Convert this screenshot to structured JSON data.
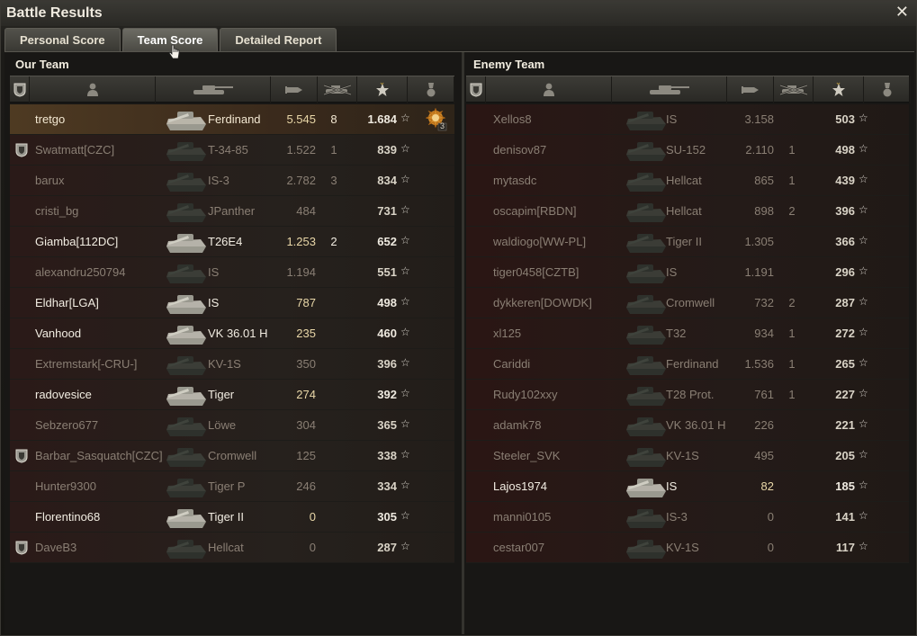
{
  "window": {
    "title": "Battle Results",
    "close_glyph": "✕"
  },
  "tabs": [
    {
      "label": "Personal Score",
      "active": false
    },
    {
      "label": "Team Score",
      "active": true
    },
    {
      "label": "Detailed Report",
      "active": false
    }
  ],
  "icons": {
    "platoon": "shield-icon",
    "player": "player-silhouette-icon",
    "vehicle": "tank-icon",
    "damage": "shell-icon",
    "kills": "destroyed-tank-icon",
    "xp": "star-icon",
    "medals": "medal-icon",
    "sort": "sort-arrow-icon"
  },
  "colors": {
    "player_row": "#4e3a22",
    "bright_text": "#f2ede2",
    "dim_text": "#8a7f74",
    "accent": "#c8a440"
  },
  "our_team": {
    "title": "Our Team",
    "sorted_column": "xp",
    "rows": [
      {
        "platoon": false,
        "name": "tretgo",
        "tank": "Ferdinand",
        "damage": "5.545",
        "kills": "8",
        "xp": "1.684",
        "alive": true,
        "player": true,
        "medal": "3"
      },
      {
        "platoon": true,
        "name": "Swatmatt[CZC]",
        "tank": "T-34-85",
        "damage": "1.522",
        "kills": "1",
        "xp": "839",
        "alive": false
      },
      {
        "platoon": false,
        "name": "barux",
        "tank": "IS-3",
        "damage": "2.782",
        "kills": "3",
        "xp": "834",
        "alive": false
      },
      {
        "platoon": false,
        "name": "cristi_bg",
        "tank": "JPanther",
        "damage": "484",
        "kills": "",
        "xp": "731",
        "alive": false
      },
      {
        "platoon": false,
        "name": "Giamba[112DC]",
        "tank": "T26E4",
        "damage": "1.253",
        "kills": "2",
        "xp": "652",
        "alive": true
      },
      {
        "platoon": false,
        "name": "alexandru250794",
        "tank": "IS",
        "damage": "1.194",
        "kills": "",
        "xp": "551",
        "alive": false
      },
      {
        "platoon": false,
        "name": "Eldhar[LGA]",
        "tank": "IS",
        "damage": "787",
        "kills": "",
        "xp": "498",
        "alive": true
      },
      {
        "platoon": false,
        "name": "Vanhood",
        "tank": "VK 36.01 H",
        "damage": "235",
        "kills": "",
        "xp": "460",
        "alive": true
      },
      {
        "platoon": false,
        "name": "Extremstark[-CRU-]",
        "tank": "KV-1S",
        "damage": "350",
        "kills": "",
        "xp": "396",
        "alive": false
      },
      {
        "platoon": false,
        "name": "radovesice",
        "tank": "Tiger",
        "damage": "274",
        "kills": "",
        "xp": "392",
        "alive": true
      },
      {
        "platoon": false,
        "name": "Sebzero677",
        "tank": "Löwe",
        "damage": "304",
        "kills": "",
        "xp": "365",
        "alive": false
      },
      {
        "platoon": true,
        "name": "Barbar_Sasquatch[CZC]",
        "tank": "Cromwell",
        "damage": "125",
        "kills": "",
        "xp": "338",
        "alive": false
      },
      {
        "platoon": false,
        "name": "Hunter9300",
        "tank": "Tiger P",
        "damage": "246",
        "kills": "",
        "xp": "334",
        "alive": false
      },
      {
        "platoon": false,
        "name": "Florentino68",
        "tank": "Tiger II",
        "damage": "0",
        "kills": "",
        "xp": "305",
        "alive": true
      },
      {
        "platoon": true,
        "name": "DaveB3",
        "tank": "Hellcat",
        "damage": "0",
        "kills": "",
        "xp": "287",
        "alive": false
      }
    ]
  },
  "enemy_team": {
    "title": "Enemy Team",
    "rows": [
      {
        "name": "Xellos8",
        "tank": "IS",
        "damage": "3.158",
        "kills": "",
        "xp": "503",
        "alive": false
      },
      {
        "name": "denisov87",
        "tank": "SU-152",
        "damage": "2.110",
        "kills": "1",
        "xp": "498",
        "alive": false
      },
      {
        "name": "mytasdc",
        "tank": "Hellcat",
        "damage": "865",
        "kills": "1",
        "xp": "439",
        "alive": false
      },
      {
        "name": "oscapim[RBDN]",
        "tank": "Hellcat",
        "damage": "898",
        "kills": "2",
        "xp": "396",
        "alive": false
      },
      {
        "name": "waldiogo[WW-PL]",
        "tank": "Tiger II",
        "damage": "1.305",
        "kills": "",
        "xp": "366",
        "alive": false
      },
      {
        "name": "tiger0458[CZTB]",
        "tank": "IS",
        "damage": "1.191",
        "kills": "",
        "xp": "296",
        "alive": false
      },
      {
        "name": "dykkeren[DOWDK]",
        "tank": "Cromwell",
        "damage": "732",
        "kills": "2",
        "xp": "287",
        "alive": false
      },
      {
        "name": "xl125",
        "tank": "T32",
        "damage": "934",
        "kills": "1",
        "xp": "272",
        "alive": false
      },
      {
        "name": "Cariddi",
        "tank": "Ferdinand",
        "damage": "1.536",
        "kills": "1",
        "xp": "265",
        "alive": false
      },
      {
        "name": "Rudy102xxy",
        "tank": "T28 Prot.",
        "damage": "761",
        "kills": "1",
        "xp": "227",
        "alive": false
      },
      {
        "name": "adamk78",
        "tank": "VK 36.01 H",
        "damage": "226",
        "kills": "",
        "xp": "221",
        "alive": false
      },
      {
        "name": "Steeler_SVK",
        "tank": "KV-1S",
        "damage": "495",
        "kills": "",
        "xp": "205",
        "alive": false
      },
      {
        "name": "Lajos1974",
        "tank": "IS",
        "damage": "82",
        "kills": "",
        "xp": "185",
        "alive": true
      },
      {
        "name": "manni0105",
        "tank": "IS-3",
        "damage": "0",
        "kills": "",
        "xp": "141",
        "alive": false
      },
      {
        "name": "cestar007",
        "tank": "KV-1S",
        "damage": "0",
        "kills": "",
        "xp": "117",
        "alive": false
      }
    ]
  }
}
